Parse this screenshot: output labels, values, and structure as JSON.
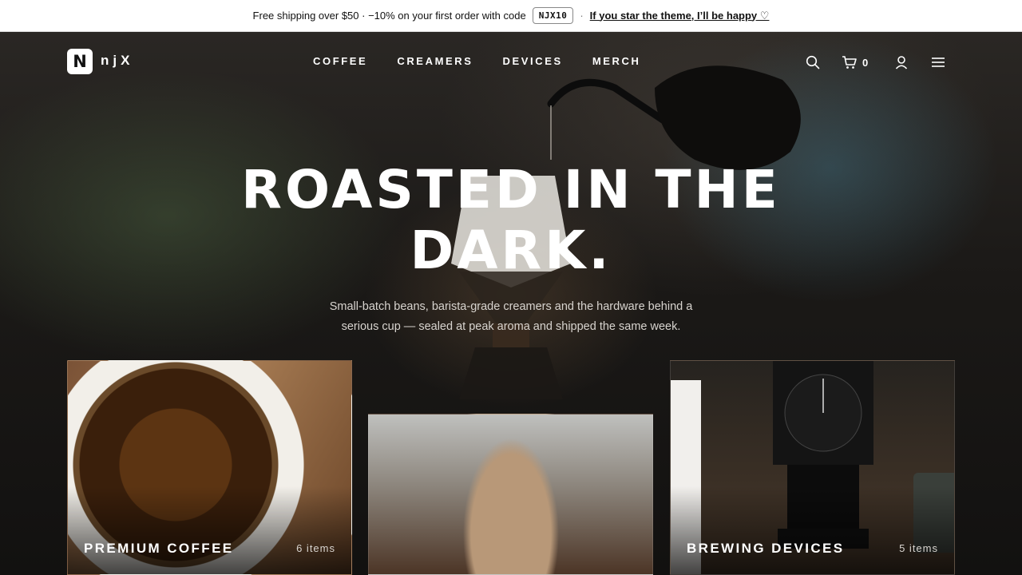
{
  "announcement": {
    "text": "Free shipping over $50 · −10% on your first order with code",
    "code": "NJX10",
    "separator": "·",
    "link": "If you star the theme, I’ll be happy ♡"
  },
  "header": {
    "logo_mark": "N",
    "logo_text": "njX",
    "nav": [
      "COFFEE",
      "CREAMERS",
      "DEVICES",
      "MERCH"
    ],
    "cart_count": "0",
    "icons": [
      "search-icon",
      "cart-icon",
      "user-icon",
      "menu-icon"
    ]
  },
  "hero": {
    "title_line1": "ROASTED IN THE",
    "title_line2": "DARK.",
    "subtitle_line1": "Small-batch beans, barista-grade creamers and the hardware behind a",
    "subtitle_line2": "serious cup — sealed at peak aroma and shipped the same week."
  },
  "cards": [
    {
      "title": "PREMIUM COFFEE",
      "count": "6 items"
    },
    {
      "title": "",
      "count": ""
    },
    {
      "title": "BREWING DEVICES",
      "count": "5 items"
    }
  ],
  "colors": {
    "background": "#121110",
    "announcement_bg": "#ffffff",
    "text_primary": "#ffffff",
    "text_muted": "#d8d4cf"
  }
}
